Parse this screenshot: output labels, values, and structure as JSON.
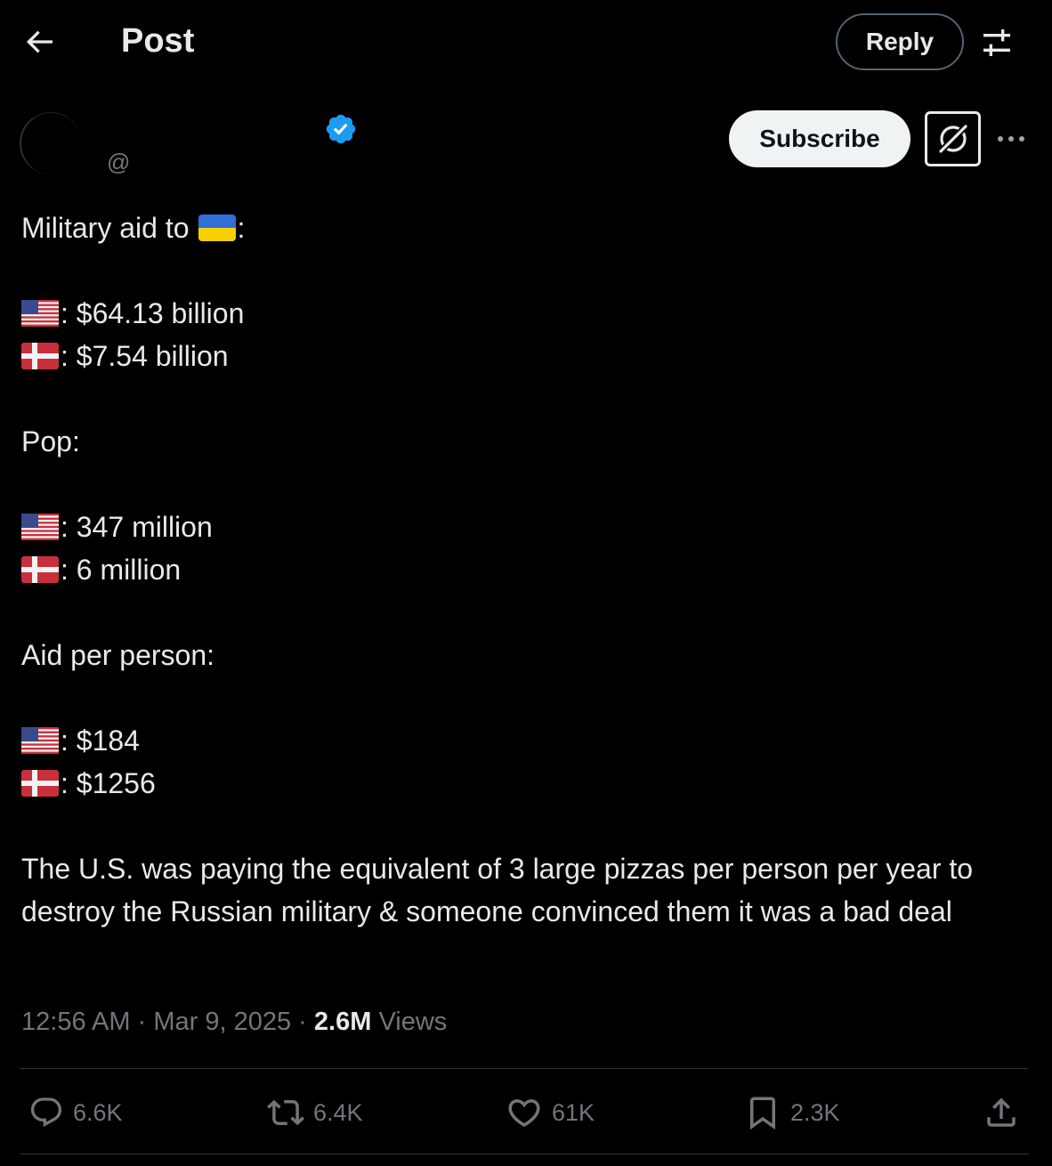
{
  "header": {
    "title": "Post",
    "reply_label": "Reply",
    "back_icon": "arrow-left-icon",
    "filter_icon": "sliders-icon"
  },
  "author": {
    "display_name": "",
    "handle": "@",
    "verified": true,
    "subscribe_label": "Subscribe",
    "grok_icon": "grok-icon",
    "more_icon": "more-horizontal-icon",
    "verified_color": "#1d9bf0"
  },
  "post": {
    "heading": "Military aid to",
    "heading_suffix": ":",
    "heading_flag": "ukraine-flag-icon",
    "aid": [
      {
        "flag": "us-flag-icon",
        "text": ": $64.13 billion"
      },
      {
        "flag": "denmark-flag-icon",
        "text": ": $7.54 billion"
      }
    ],
    "pop_heading": "Pop:",
    "pop": [
      {
        "flag": "us-flag-icon",
        "text": ": 347 million"
      },
      {
        "flag": "denmark-flag-icon",
        "text": ": 6 million"
      }
    ],
    "per_person_heading": "Aid per person:",
    "per_person": [
      {
        "flag": "us-flag-icon",
        "text": ": $184"
      },
      {
        "flag": "denmark-flag-icon",
        "text": ": $1256"
      }
    ],
    "closing": "The U.S. was paying the equivalent of 3 large pizzas per person per year to destroy the Russian military & someone convinced them it was a bad deal"
  },
  "meta": {
    "time": "12:56 AM",
    "date": "Mar 9, 2025",
    "separator": "·",
    "views_count": "2.6M",
    "views_label": "Views"
  },
  "actions": {
    "replies": "6.6K",
    "reposts": "6.4K",
    "likes": "61K",
    "bookmarks": "2.3K",
    "share_icon": "share-icon"
  }
}
